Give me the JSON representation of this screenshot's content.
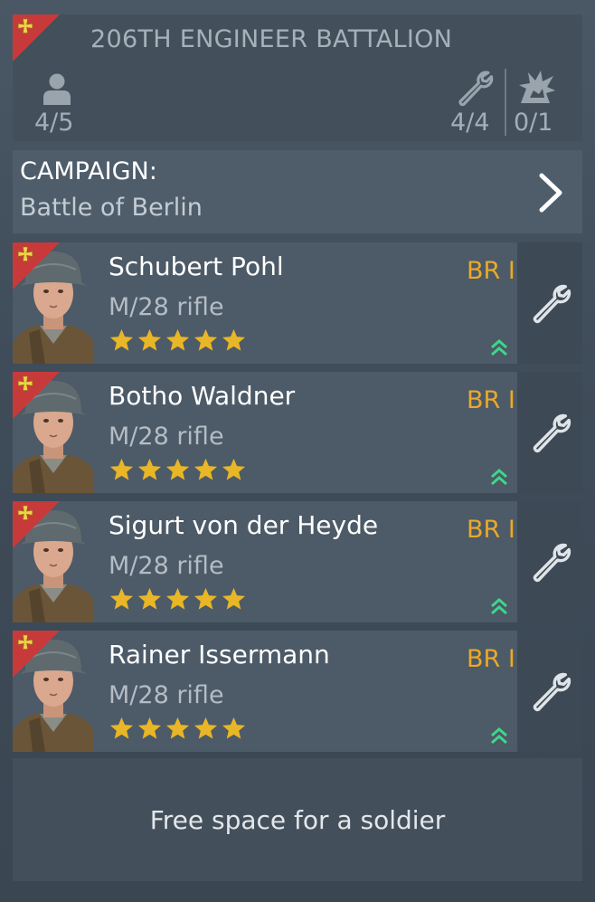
{
  "squad": {
    "title": "206TH ENGINEER BATTALION",
    "soldiers_count": "4/5",
    "engineers_count": "4/4",
    "special_count": "0/1",
    "icons": {
      "rank": "iron-cross-icon",
      "soldiers": "person-icon",
      "engineers": "wrench-icon",
      "special": "explosion-icon"
    }
  },
  "campaign": {
    "label": "CAMPAIGN:",
    "value": "Battle of Berlin",
    "arrow_icon": "chevron-right-icon"
  },
  "soldiers": [
    {
      "name": "Schubert Pohl",
      "weapon": "M/28 rifle",
      "br": "BR I",
      "stars": 5
    },
    {
      "name": "Botho Waldner",
      "weapon": "M/28 rifle",
      "br": "BR I",
      "stars": 5
    },
    {
      "name": "Sigurt von der Heyde",
      "weapon": "M/28 rifle",
      "br": "BR I",
      "stars": 5
    },
    {
      "name": "Rainer Issermann",
      "weapon": "M/28 rifle",
      "br": "BR I",
      "stars": 5
    }
  ],
  "free_slot": {
    "label": "Free space for a soldier"
  },
  "colors": {
    "accent_red": "#c83a3a",
    "br_gold": "#e9a92a",
    "star_gold": "#e8b626",
    "rank_up_green": "#3ed68a"
  }
}
